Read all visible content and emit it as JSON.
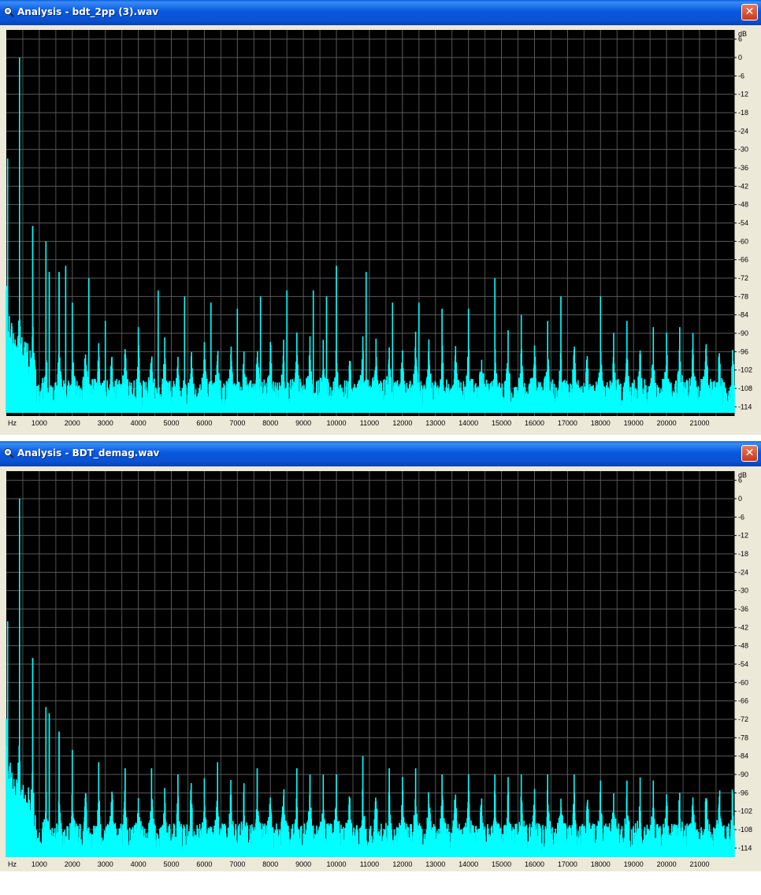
{
  "windows": [
    {
      "title": "Analysis - bdt_2pp (3).wav",
      "close_label": "✕",
      "icon": "analysis-app-icon"
    },
    {
      "title": "Analysis - BDT_demag.wav",
      "close_label": "✕",
      "icon": "analysis-app-icon"
    }
  ],
  "colors": {
    "plot_background": "#000000",
    "grid": "#5a5a5a",
    "trace": "#00ffff",
    "panel": "#ece9d8"
  },
  "chart_data": [
    {
      "type": "area",
      "xunit": "Hz",
      "yunit": "dB",
      "xlim": [
        0,
        22050
      ],
      "ylim": [
        -117,
        9
      ],
      "x_ticks": [
        "1000",
        "2000",
        "3000",
        "4000",
        "5000",
        "6000",
        "7000",
        "8000",
        "9000",
        "10000",
        "11000",
        "12000",
        "13000",
        "14000",
        "15000",
        "16000",
        "17000",
        "18000",
        "19000",
        "20000",
        "21000"
      ],
      "y_ticks": [
        "6",
        "0",
        "-6",
        "-12",
        "-18",
        "-24",
        "-30",
        "-36",
        "-42",
        "-48",
        "-54",
        "-60",
        "-66",
        "-72",
        "-78",
        "-84",
        "-90",
        "-96",
        "-102",
        "-108",
        "-114"
      ],
      "grid": true,
      "series": [
        {
          "peaks": [
            {
              "x": 40,
              "y": -33
            },
            {
              "x": 400,
              "y": 0
            },
            {
              "x": 800,
              "y": -55
            },
            {
              "x": 1200,
              "y": -60
            },
            {
              "x": 1300,
              "y": -70
            },
            {
              "x": 1600,
              "y": -70
            },
            {
              "x": 1800,
              "y": -68
            },
            {
              "x": 2000,
              "y": -80
            },
            {
              "x": 2500,
              "y": -72
            },
            {
              "x": 3000,
              "y": -86
            },
            {
              "x": 4000,
              "y": -88
            },
            {
              "x": 4600,
              "y": -76
            },
            {
              "x": 5400,
              "y": -78
            },
            {
              "x": 6200,
              "y": -80
            },
            {
              "x": 7000,
              "y": -82
            },
            {
              "x": 7700,
              "y": -78
            },
            {
              "x": 8500,
              "y": -76
            },
            {
              "x": 9300,
              "y": -76
            },
            {
              "x": 9700,
              "y": -78
            },
            {
              "x": 10000,
              "y": -68
            },
            {
              "x": 10900,
              "y": -70
            },
            {
              "x": 11700,
              "y": -80
            },
            {
              "x": 12500,
              "y": -80
            },
            {
              "x": 13200,
              "y": -82
            },
            {
              "x": 14000,
              "y": -82
            },
            {
              "x": 14800,
              "y": -72
            },
            {
              "x": 15600,
              "y": -84
            },
            {
              "x": 16400,
              "y": -86
            },
            {
              "x": 16800,
              "y": -78
            },
            {
              "x": 18000,
              "y": -78
            },
            {
              "x": 18800,
              "y": -86
            },
            {
              "x": 19600,
              "y": -88
            },
            {
              "x": 20400,
              "y": -88
            },
            {
              "x": 21200,
              "y": -94
            }
          ],
          "harmonic_spacing_hz": 400,
          "floor_db": -114
        }
      ]
    },
    {
      "type": "area",
      "xunit": "Hz",
      "yunit": "dB",
      "xlim": [
        0,
        22050
      ],
      "ylim": [
        -117,
        9
      ],
      "x_ticks": [
        "1000",
        "2000",
        "3000",
        "4000",
        "5000",
        "6000",
        "7000",
        "8000",
        "9000",
        "10000",
        "11000",
        "12000",
        "13000",
        "14000",
        "15000",
        "16000",
        "17000",
        "18000",
        "19000",
        "20000",
        "21000"
      ],
      "y_ticks": [
        "6",
        "0",
        "-6",
        "-12",
        "-18",
        "-24",
        "-30",
        "-36",
        "-42",
        "-48",
        "-54",
        "-60",
        "-66",
        "-72",
        "-78",
        "-84",
        "-90",
        "-96",
        "-102",
        "-108",
        "-114"
      ],
      "grid": true,
      "series": [
        {
          "peaks": [
            {
              "x": 40,
              "y": -40
            },
            {
              "x": 400,
              "y": 0
            },
            {
              "x": 800,
              "y": -52
            },
            {
              "x": 1200,
              "y": -68
            },
            {
              "x": 1300,
              "y": -70
            },
            {
              "x": 1600,
              "y": -76
            },
            {
              "x": 2000,
              "y": -82
            },
            {
              "x": 2800,
              "y": -86
            },
            {
              "x": 3600,
              "y": -88
            },
            {
              "x": 4400,
              "y": -88
            },
            {
              "x": 5200,
              "y": -90
            },
            {
              "x": 6400,
              "y": -86
            },
            {
              "x": 7600,
              "y": -88
            },
            {
              "x": 8800,
              "y": -88
            },
            {
              "x": 9200,
              "y": -90
            },
            {
              "x": 10000,
              "y": -90
            },
            {
              "x": 10800,
              "y": -84
            },
            {
              "x": 11600,
              "y": -88
            },
            {
              "x": 12400,
              "y": -88
            },
            {
              "x": 13200,
              "y": -90
            },
            {
              "x": 14000,
              "y": -90
            },
            {
              "x": 14800,
              "y": -90
            },
            {
              "x": 15600,
              "y": -90
            },
            {
              "x": 16400,
              "y": -90
            },
            {
              "x": 17200,
              "y": -90
            },
            {
              "x": 18000,
              "y": -92
            },
            {
              "x": 18800,
              "y": -92
            },
            {
              "x": 19600,
              "y": -92
            },
            {
              "x": 20400,
              "y": -96
            },
            {
              "x": 21200,
              "y": -102
            }
          ],
          "harmonic_spacing_hz": 400,
          "floor_db": -115
        }
      ]
    }
  ]
}
